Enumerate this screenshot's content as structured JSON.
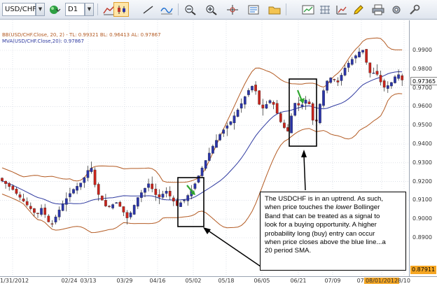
{
  "toolbar": {
    "symbol": "USD/CHF",
    "timeframe": "D1"
  },
  "legend": {
    "bollinger": "BB(USD/CHF.Close, 20, 2) - TL: 0.99321  BL: 0.96413  AL: 0.97867",
    "moving_average": "MVA(USD/CHF.Close,20): 0.97867"
  },
  "price_axis": {
    "ticks": [
      "0.9900",
      "0.9800",
      "0.9700",
      "0.9600",
      "0.9500",
      "0.9400",
      "0.9300",
      "0.9200",
      "0.9100",
      "0.9000",
      "0.8900"
    ],
    "current_price": "0.97365",
    "low_marker": "0.87911"
  },
  "time_axis": {
    "ticks": [
      "01/31/2012",
      "02/24",
      "03/13",
      "03/29",
      "04/16",
      "05/02",
      "05/18",
      "06/05",
      "06/21",
      "07/09",
      "07/",
      "08/01/2012",
      "8/10"
    ]
  },
  "annotation": {
    "line1": "The USDCHF is in an uptrend.  As such,",
    "line2a": "when price touches the ",
    "line2b": "lower",
    "line2c": " Bollinger",
    "line3": "Band that can be treated as a signal to",
    "line4": "look for a buying opportunity.  A higher",
    "line5": "probability long (buy) entry can occur",
    "line6": "when price closes above the blue line...a",
    "line7": "20 period SMA."
  },
  "colors": {
    "bull_candle": "#2b35a8",
    "bear_candle": "#c8241c",
    "bollinger_band": "#b35a22",
    "moving_average": "#2f3aa0",
    "signal_arrow": "#2fa62f",
    "active_label": "#f5a623"
  }
}
